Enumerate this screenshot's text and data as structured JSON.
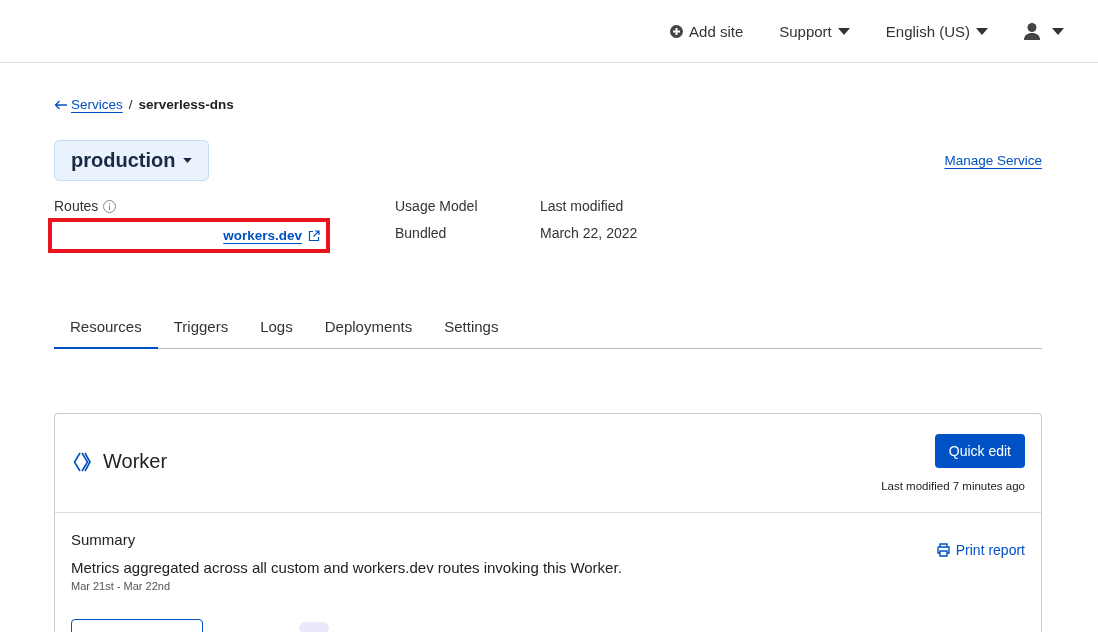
{
  "header": {
    "add_site": "Add site",
    "menus": [
      {
        "label": "Support"
      },
      {
        "label": "English (US)"
      }
    ]
  },
  "breadcrumb": {
    "back": "Services",
    "separator": "/",
    "current": "serverless-dns"
  },
  "environment": {
    "label": "production"
  },
  "manage_service": "Manage Service",
  "details": [
    {
      "label": "Routes",
      "kind": "link",
      "value": "workers.dev",
      "highlighted": true
    },
    {
      "label": "Usage Model",
      "kind": "text",
      "value": "Bundled",
      "highlighted": false
    },
    {
      "label": "Last modified",
      "kind": "text",
      "value": "March 22, 2022",
      "highlighted": false
    }
  ],
  "tabs": [
    {
      "label": "Resources",
      "selected": true
    },
    {
      "label": "Triggers",
      "selected": false
    },
    {
      "label": "Logs",
      "selected": false
    },
    {
      "label": "Deployments",
      "selected": false
    },
    {
      "label": "Settings",
      "selected": false
    }
  ],
  "card": {
    "title": "Worker",
    "button": "Quick edit",
    "last_modified": "Last modified 7 minutes ago",
    "summary": {
      "title": "Summary",
      "description": "Metrics aggregated across all custom and workers.dev routes invoking this Worker.",
      "range": "Mar 21st - Mar 22nd",
      "print": "Print report"
    }
  }
}
